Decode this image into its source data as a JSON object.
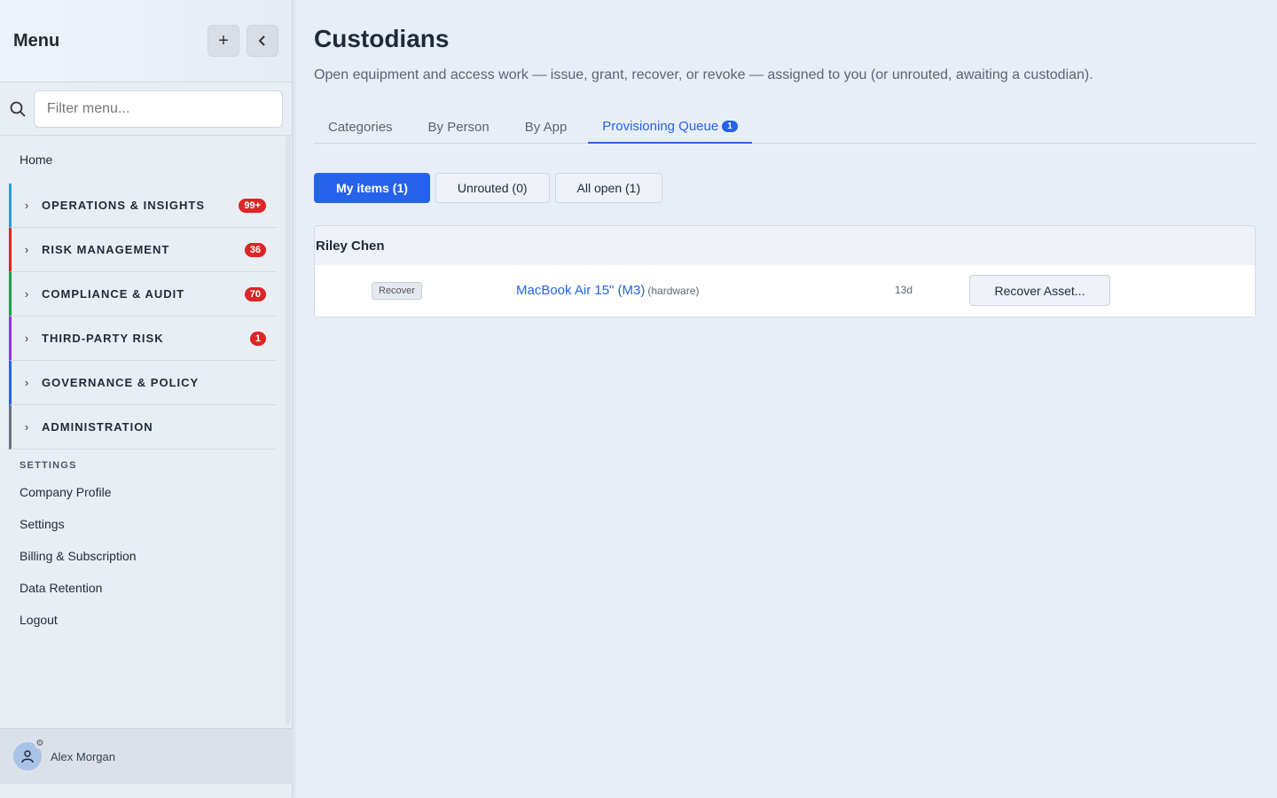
{
  "sidebar": {
    "title": "Menu",
    "add_label": "+",
    "collapse_label": "‹",
    "search_placeholder": "Filter menu...",
    "home": "Home",
    "groups": [
      {
        "label": "OPERATIONS & INSIGHTS",
        "badge": "99+",
        "color": "#2a9fd6"
      },
      {
        "label": "RISK MANAGEMENT",
        "badge": "36",
        "color": "#dc2626"
      },
      {
        "label": "COMPLIANCE & AUDIT",
        "badge": "70",
        "color": "#16a34a"
      },
      {
        "label": "THIRD-PARTY RISK",
        "badge": "1",
        "color": "#9333ea"
      },
      {
        "label": "GOVERNANCE & POLICY",
        "badge": "",
        "color": "#2563eb"
      },
      {
        "label": "ADMINISTRATION",
        "badge": "",
        "color": "#6b7280"
      }
    ],
    "settings_label": "SETTINGS",
    "settings_items": [
      "Company Profile",
      "Settings",
      "Billing & Subscription",
      "Data Retention",
      "Logout"
    ],
    "user_name": "Alex Morgan"
  },
  "main": {
    "title": "Custodians",
    "subtitle": "Open equipment and access work — issue, grant, recover, or revoke — assigned to you (or unrouted, awaiting a custodian).",
    "tabs": [
      {
        "label": "Categories"
      },
      {
        "label": "By Person"
      },
      {
        "label": "By App"
      },
      {
        "label": "Provisioning Queue",
        "badge": "1",
        "active": true
      }
    ],
    "filters": [
      "My items (1)",
      "Unrouted (0)",
      "All open (1)"
    ],
    "group": {
      "person": "Riley Chen",
      "rows": [
        {
          "action": "Recover",
          "asset": "MacBook Air 15\" (M3)",
          "type": "(hardware)",
          "age": "13d",
          "button": "Recover Asset..."
        }
      ]
    }
  },
  "colors": {
    "accent": "#2563eb",
    "badge": "#dc2626"
  }
}
